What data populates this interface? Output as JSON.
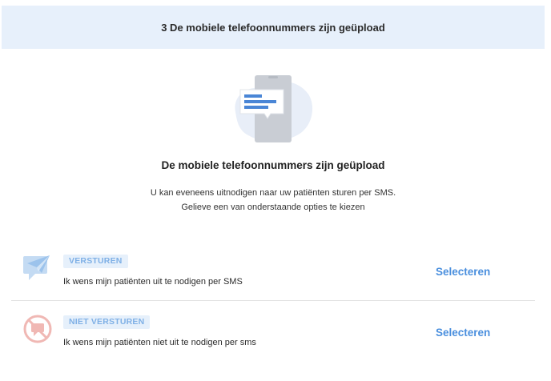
{
  "banner": {
    "title": "3 De mobiele telefoonnummers zijn geüpload"
  },
  "illustration": {
    "icon": "phone-message-icon"
  },
  "main": {
    "title": "De mobiele telefoonnummers zijn geüpload",
    "line1": "U kan eveneens uitnodigen naar uw patiënten sturen per SMS.",
    "line2": "Gelieve een van onderstaande opties te kiezen"
  },
  "options": [
    {
      "badge": "VERSTUREN",
      "description": "Ik wens mijn patiënten uit te nodigen per SMS",
      "select_label": "Selecteren",
      "icon": "send-message-icon"
    },
    {
      "badge": "NIET VERSTUREN",
      "description": "Ik wens mijn patiënten niet uit te nodigen per sms",
      "select_label": "Selecteren",
      "icon": "no-message-icon"
    }
  ],
  "colors": {
    "accent": "#4a8fde",
    "banner_bg": "#e7f0fb",
    "badge_bg": "#e6f0fb",
    "badge_text": "#7fb0e6",
    "no_send_icon": "#f0b8b4"
  }
}
